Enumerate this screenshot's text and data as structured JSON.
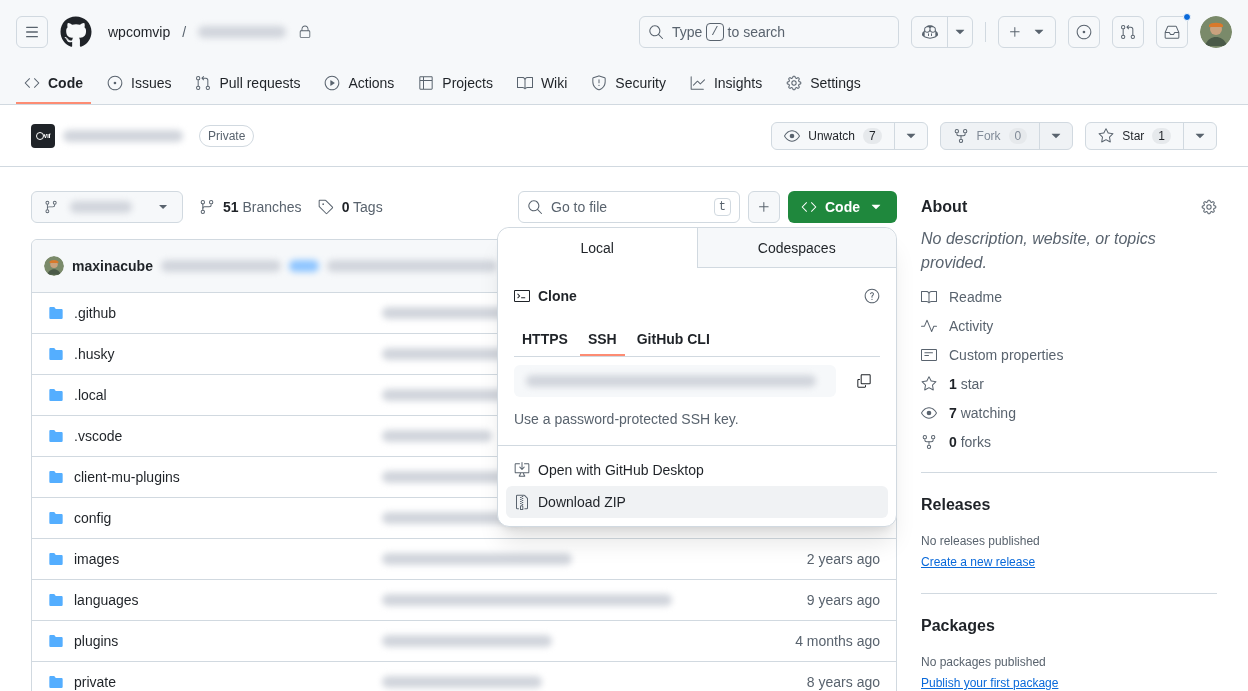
{
  "header": {
    "owner": "wpcomvip",
    "separator": "/",
    "search": {
      "before": "Type",
      "key": "/",
      "after": "to search"
    },
    "notification_unread": true
  },
  "repo_nav": [
    {
      "label": "Code",
      "selected": true
    },
    {
      "label": "Issues",
      "selected": false
    },
    {
      "label": "Pull requests",
      "selected": false
    },
    {
      "label": "Actions",
      "selected": false
    },
    {
      "label": "Projects",
      "selected": false
    },
    {
      "label": "Wiki",
      "selected": false
    },
    {
      "label": "Security",
      "selected": false
    },
    {
      "label": "Insights",
      "selected": false
    },
    {
      "label": "Settings",
      "selected": false
    }
  ],
  "repo_title": {
    "badge": "Private",
    "actions": [
      {
        "label": "Unwatch",
        "count": "7",
        "disabled": false
      },
      {
        "label": "Fork",
        "count": "0",
        "disabled": true
      },
      {
        "label": "Star",
        "count": "1",
        "disabled": false
      }
    ]
  },
  "toolbar": {
    "branches": {
      "count": "51",
      "label": "Branches"
    },
    "tags": {
      "count": "0",
      "label": "Tags"
    },
    "go_to_file": {
      "placeholder": "Go to file",
      "key": "t"
    },
    "code_button": "Code"
  },
  "commit": {
    "author": "maxinacube"
  },
  "files": [
    {
      "name": ".github"
    },
    {
      "name": ".husky"
    },
    {
      "name": ".local"
    },
    {
      "name": ".vscode"
    },
    {
      "name": "client-mu-plugins"
    },
    {
      "name": "config"
    },
    {
      "name": "images",
      "time": "2 years ago"
    },
    {
      "name": "languages",
      "time": "9 years ago"
    },
    {
      "name": "plugins",
      "time": "4 months ago"
    },
    {
      "name": "private",
      "time": "8 years ago"
    }
  ],
  "clone_menu": {
    "tabs": [
      {
        "label": "Local",
        "selected": true
      },
      {
        "label": "Codespaces",
        "selected": false
      }
    ],
    "title": "Clone",
    "protocols": [
      {
        "label": "HTTPS",
        "selected": false
      },
      {
        "label": "SSH",
        "selected": true
      },
      {
        "label": "GitHub CLI",
        "selected": false
      }
    ],
    "hint": "Use a password-protected SSH key.",
    "actions": [
      {
        "label": "Open with GitHub Desktop",
        "highlighted": false
      },
      {
        "label": "Download ZIP",
        "highlighted": true
      }
    ]
  },
  "about": {
    "title": "About",
    "description": "No description, website, or topics provided.",
    "items": [
      {
        "label": "Readme"
      },
      {
        "label": "Activity"
      },
      {
        "label": "Custom properties"
      },
      {
        "count": "1",
        "label": "star"
      },
      {
        "count": "7",
        "label": "watching"
      },
      {
        "count": "0",
        "label": "forks"
      }
    ]
  },
  "releases": {
    "title": "Releases",
    "note": "No releases published",
    "link": "Create a new release"
  },
  "packages": {
    "title": "Packages",
    "note": "No packages published",
    "link": "Publish your first package"
  }
}
